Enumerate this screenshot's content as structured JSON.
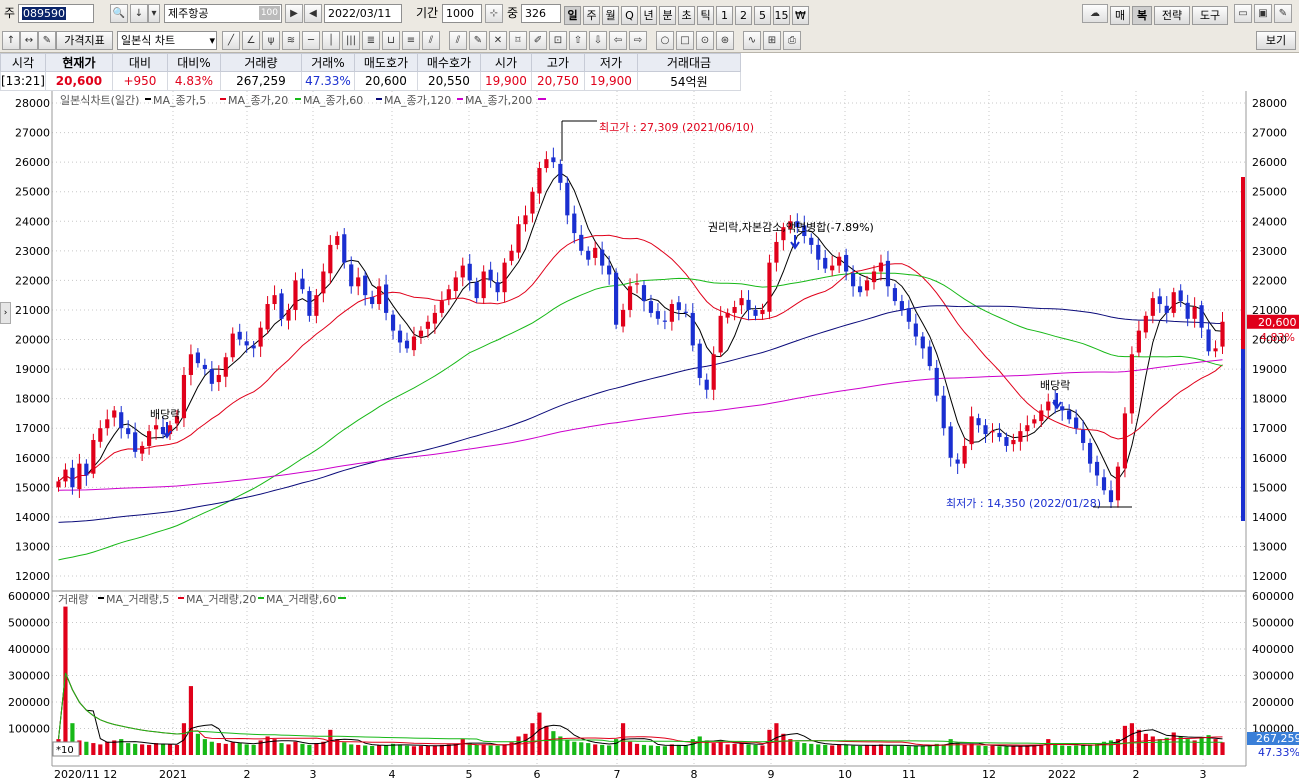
{
  "toolbar1": {
    "market_label": "주",
    "code": "089590",
    "name": "제주항공",
    "name_badge": "100",
    "date": "2022/03/11",
    "period_label": "기간",
    "period_value": "1000",
    "count_label": "중",
    "count_value": "326",
    "timeframes": [
      "일",
      "주",
      "월",
      "Q",
      "년",
      "분",
      "초",
      "틱",
      "1",
      "2",
      "5",
      "15",
      "₩"
    ],
    "right_buttons": [
      "매",
      "복",
      "전략",
      "도구"
    ]
  },
  "toolbar2": {
    "indicator_dropdown": "가격지표",
    "chart_type_dropdown": "일본식 차트",
    "view_button": "보기"
  },
  "quote": {
    "headers": [
      "시각",
      "현재가",
      "대비",
      "대비%",
      "거래량",
      "거래%",
      "매도호가",
      "매수호가",
      "시가",
      "고가",
      "저가",
      "거래대금"
    ],
    "values": [
      "[13:21]",
      "20,600",
      "+950",
      "4.83%",
      "267,259",
      "47.33%",
      "20,600",
      "20,550",
      "19,900",
      "20,750",
      "19,900",
      "54억원"
    ]
  },
  "colors": {
    "up": "#e0001a",
    "down": "#1a2fd0",
    "ma5": "#000000",
    "ma20": "#e0001a",
    "ma60": "#17b817",
    "ma120": "#0a0a7a",
    "ma200": "#cc00cc"
  },
  "chart_data": {
    "type": "candlestick",
    "price_legend": {
      "title": "일본식차트(일간)",
      "items": [
        "MA_종가,5",
        "MA_종가,20",
        "MA_종가,60",
        "MA_종가,120",
        "MA_종가,200"
      ]
    },
    "volume_legend": {
      "title": "거래량",
      "items": [
        "MA_거래량,5",
        "MA_거래량,20",
        "MA_거래량,60"
      ]
    },
    "price_axis": {
      "min": 12000,
      "max": 28000,
      "ticks": [
        12000,
        13000,
        14000,
        15000,
        16000,
        17000,
        18000,
        19000,
        20000,
        21000,
        22000,
        23000,
        24000,
        25000,
        26000,
        27000,
        28000
      ]
    },
    "volume_axis": {
      "min": 0,
      "max": 600000,
      "ticks": [
        "600000",
        "500000",
        "400000",
        "300000",
        "200000",
        "100000"
      ]
    },
    "x_labels": [
      "2020/11 12",
      "2021",
      "2",
      "3",
      "4",
      "5",
      "6",
      "7",
      "8",
      "9",
      "10",
      "11",
      "12",
      "2022",
      "2",
      "3"
    ],
    "current_price_tag": "20,600",
    "current_change_tag": "4.83%",
    "current_volume_tag": "267,259",
    "current_volume_pct_tag": "47.33%",
    "volume_scale_tag": "*10",
    "annotations": {
      "high": "최고가 : 27,309 (2021/06/10)",
      "low": "최저가 : 14,350 (2022/01/28)",
      "dividend1": "배당락",
      "dividend2": "배당락",
      "rights": "권리락,자본감소,액면병합(-7.89%)"
    },
    "close_series": [
      15200,
      15600,
      15000,
      15800,
      15400,
      16600,
      17000,
      17300,
      17600,
      17000,
      16800,
      16200,
      16400,
      16900,
      17100,
      16800,
      17100,
      17400,
      18800,
      19500,
      19200,
      19000,
      18500,
      18800,
      19400,
      20200,
      20000,
      19800,
      19700,
      20400,
      21200,
      21500,
      20700,
      21000,
      22000,
      21700,
      20800,
      21500,
      22300,
      23200,
      23500,
      22600,
      21800,
      22100,
      21500,
      21200,
      21800,
      20900,
      20300,
      19900,
      19700,
      20100,
      20300,
      20600,
      20900,
      21300,
      21700,
      22100,
      22500,
      22000,
      21400,
      22300,
      22000,
      21600,
      22600,
      23000,
      23900,
      24200,
      25000,
      25800,
      26100,
      26000,
      25300,
      24200,
      23600,
      23000,
      22700,
      23100,
      22500,
      22200,
      20500,
      21000,
      21800,
      21900,
      21300,
      20900,
      20700,
      20600,
      21200,
      21000,
      20900,
      19800,
      18700,
      18300,
      19500,
      20800,
      20900,
      21100,
      21400,
      21000,
      20800,
      21000,
      22600,
      23300,
      23800,
      24000,
      23800,
      23500,
      23200,
      22700,
      22400,
      22500,
      22800,
      22300,
      21800,
      21600,
      22000,
      22300,
      22600,
      21800,
      21300,
      21000,
      20600,
      20100,
      19700,
      19100,
      18100,
      17000,
      16000,
      15800,
      16400,
      17400,
      17100,
      16800,
      16900,
      16700,
      16400,
      16600,
      16900,
      17100,
      17300,
      17600,
      17900,
      17800,
      17600,
      17300,
      17000,
      16500,
      15800,
      15400,
      14900,
      14500,
      15700,
      17500,
      19500,
      20300,
      20800,
      21400,
      21200,
      20900,
      21600,
      21300,
      20700,
      21100,
      20400,
      19600,
      19700,
      20600
    ],
    "volume_series": [
      60000,
      560000,
      120000,
      55000,
      50000,
      45000,
      40000,
      50000,
      55000,
      60000,
      45000,
      42000,
      40000,
      38000,
      45000,
      42000,
      40000,
      38000,
      120000,
      260000,
      80000,
      60000,
      50000,
      45000,
      42000,
      48000,
      45000,
      40000,
      38000,
      55000,
      70000,
      60000,
      45000,
      40000,
      50000,
      42000,
      38000,
      45000,
      50000,
      95000,
      60000,
      48000,
      40000,
      38000,
      36000,
      34000,
      38000,
      36000,
      42000,
      40000,
      35000,
      33000,
      34000,
      36000,
      35000,
      38000,
      40000,
      42000,
      60000,
      45000,
      38000,
      40000,
      36000,
      35000,
      40000,
      48000,
      70000,
      80000,
      120000,
      160000,
      110000,
      90000,
      70000,
      55000,
      50000,
      48000,
      45000,
      40000,
      38000,
      36000,
      60000,
      120000,
      50000,
      42000,
      38000,
      36000,
      34000,
      33000,
      40000,
      38000,
      35000,
      60000,
      70000,
      55000,
      45000,
      48000,
      40000,
      42000,
      45000,
      40000,
      38000,
      36000,
      95000,
      120000,
      80000,
      60000,
      50000,
      45000,
      42000,
      40000,
      38000,
      36000,
      40000,
      38000,
      35000,
      34000,
      36000,
      38000,
      40000,
      36000,
      34000,
      35000,
      33000,
      34000,
      35000,
      38000,
      42000,
      40000,
      60000,
      45000,
      38000,
      42000,
      36000,
      34000,
      35000,
      33000,
      32000,
      33000,
      34000,
      36000,
      38000,
      40000,
      60000,
      38000,
      36000,
      34000,
      36000,
      38000,
      40000,
      42000,
      50000,
      55000,
      60000,
      110000,
      120000,
      95000,
      80000,
      70000,
      60000,
      65000,
      85000,
      70000,
      60000,
      55000,
      65000,
      75000,
      60000,
      48000
    ]
  }
}
